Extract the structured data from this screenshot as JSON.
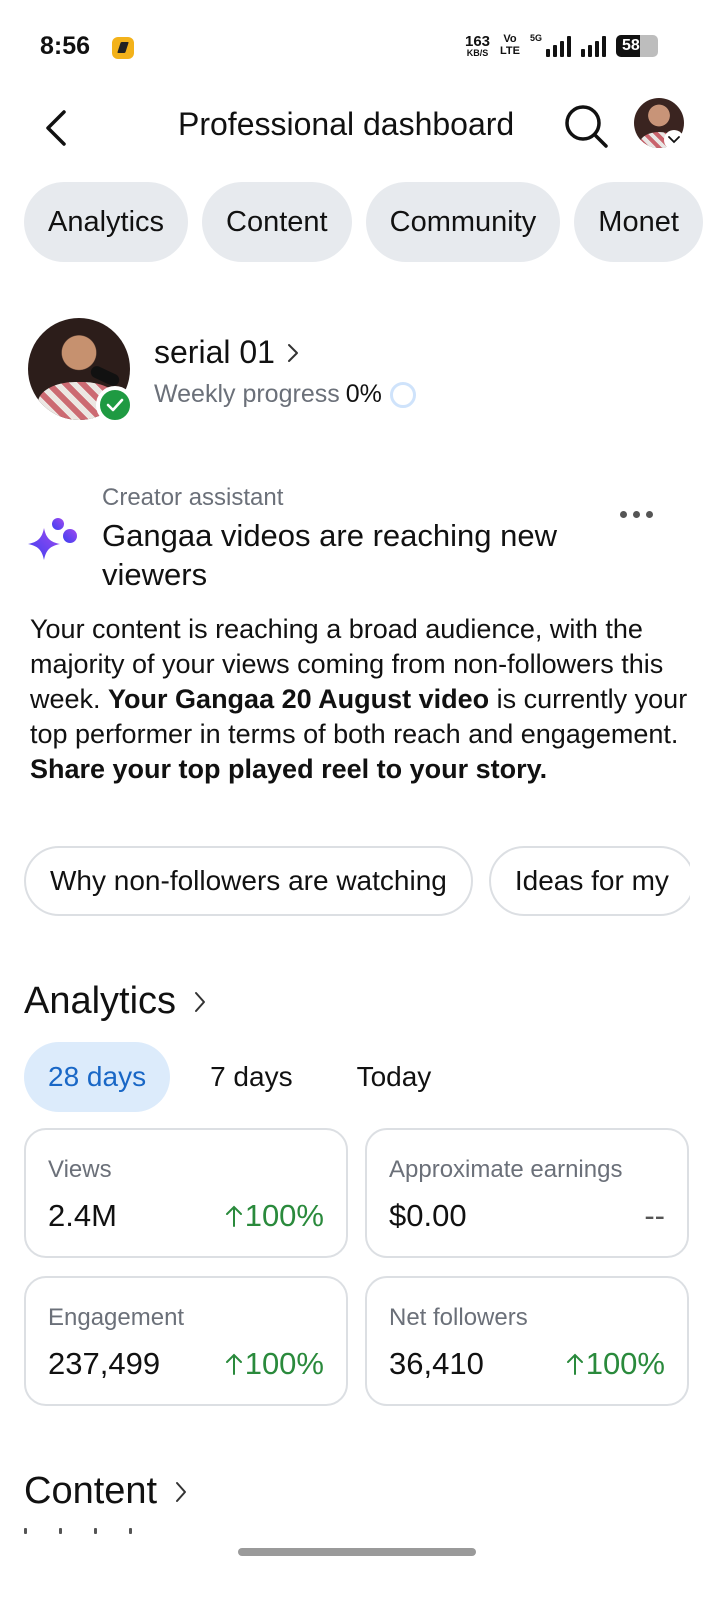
{
  "status_bar": {
    "time": "8:56",
    "net_speed_value": "163",
    "net_speed_unit": "KB/S",
    "volte_line1": "Vo",
    "volte_line2": "LTE",
    "network_label": "5G",
    "battery_level": "58",
    "battery_fraction": 0.58
  },
  "header": {
    "title": "Professional dashboard",
    "back_icon": "chevron-left-icon",
    "search_icon": "search-icon"
  },
  "tabs": [
    "Analytics",
    "Content",
    "Community",
    "Monet"
  ],
  "profile": {
    "name": "serial 01",
    "progress_label": "Weekly progress",
    "progress_value": "0%"
  },
  "assistant": {
    "label": "Creator assistant",
    "title": "Gangaa videos are reaching new viewers",
    "body_1": "Your content is reaching a broad audience, with the majority of your views coming from non-followers this week. ",
    "body_bold_1": "Your Gangaa 20 August video",
    "body_2": " is currently your top performer in terms of both reach and engagement. ",
    "body_bold_2": "Share your top played reel to your story.",
    "chips": [
      "Why non-followers are watching",
      "Ideas for my"
    ]
  },
  "analytics": {
    "title": "Analytics",
    "ranges": [
      "28 days",
      "7 days",
      "Today"
    ],
    "selected_range": "28 days",
    "cards": {
      "views": {
        "label": "Views",
        "value": "2.4M",
        "delta": "100%"
      },
      "earnings": {
        "label": "Approximate earnings",
        "value": "$0.00",
        "delta": "--"
      },
      "engagement": {
        "label": "Engagement",
        "value": "237,499",
        "delta": "100%"
      },
      "followers": {
        "label": "Net followers",
        "value": "36,410",
        "delta": "100%"
      }
    }
  },
  "content": {
    "title": "Content"
  },
  "colors": {
    "accent_blue": "#1967c6",
    "selected_range_bg": "#dcebfb",
    "positive_green": "#2a8a3c",
    "verified_green": "#1f9a42",
    "chip_bg": "#e7eaee"
  }
}
